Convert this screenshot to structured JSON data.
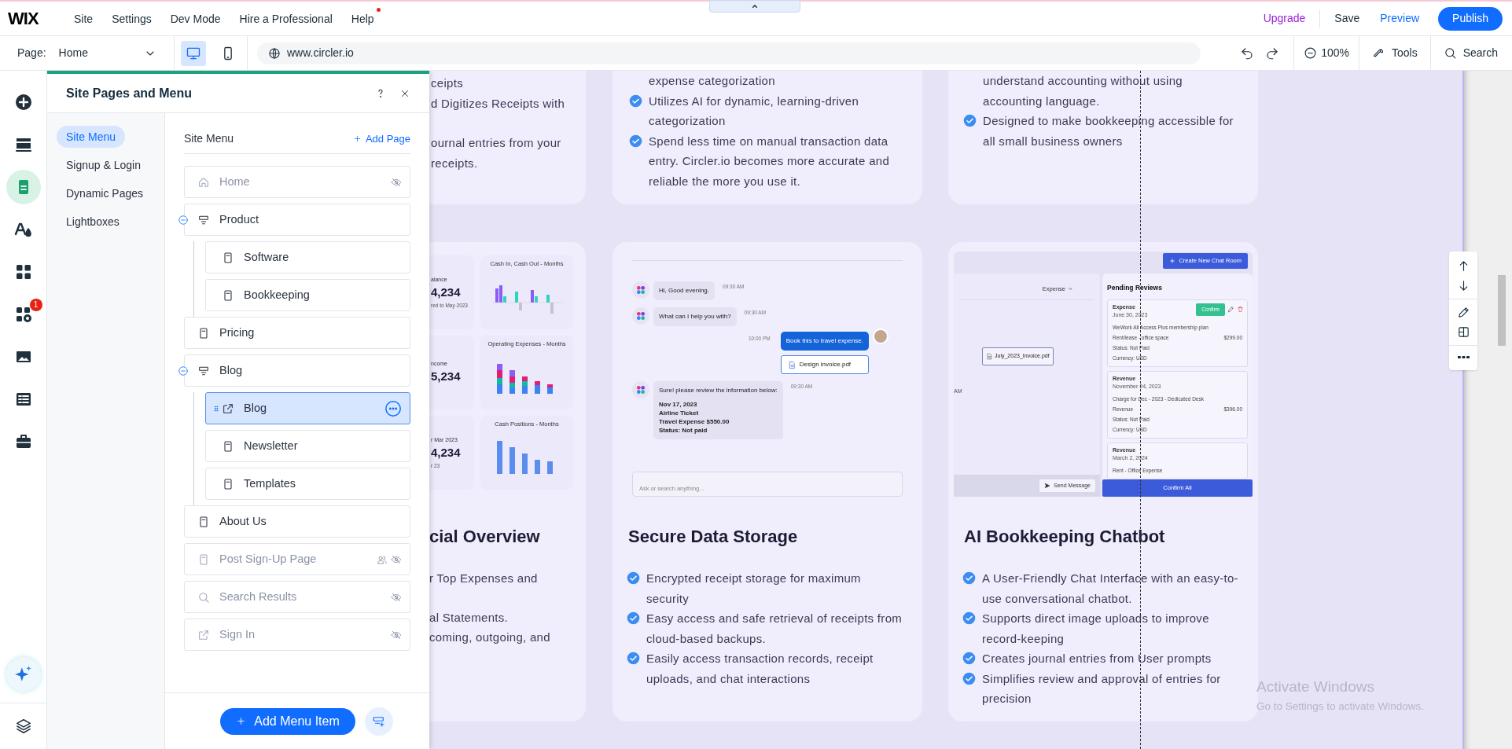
{
  "top_bar": {
    "logo": "WIX",
    "menu": [
      {
        "label": "Site"
      },
      {
        "label": "Settings"
      },
      {
        "label": "Dev Mode"
      },
      {
        "label": "Hire a Professional"
      },
      {
        "label": "Help",
        "notification": true
      }
    ],
    "upgrade": "Upgrade",
    "save": "Save",
    "preview": "Preview",
    "publish": "Publish"
  },
  "toolbar": {
    "page_label": "Page:",
    "page": "Home",
    "views": [
      {
        "kind": "desktop",
        "selected": true
      },
      {
        "kind": "mobile",
        "selected": false
      }
    ],
    "url": "www.circler.io",
    "zoom": "100%",
    "tools": "Tools",
    "search": "Search"
  },
  "left_rail": [
    {
      "kind": "add",
      "selected": false
    },
    {
      "kind": "sections",
      "selected": false
    },
    {
      "kind": "pages",
      "selected": true
    },
    {
      "kind": "design",
      "selected": false
    },
    {
      "kind": "apps",
      "selected": false
    },
    {
      "kind": "market",
      "selected": false,
      "badge": "1"
    },
    {
      "kind": "media",
      "selected": false
    },
    {
      "kind": "cms",
      "selected": false
    },
    {
      "kind": "business",
      "selected": false
    }
  ],
  "rail_bottom": [
    {
      "kind": "ai"
    },
    {
      "kind": "layers"
    }
  ],
  "panel": {
    "title": "Site Pages and Menu",
    "nav": [
      {
        "label": "Site Menu",
        "selected": true
      },
      {
        "label": "Signup & Login",
        "selected": false
      },
      {
        "label": "Dynamic Pages",
        "selected": false
      },
      {
        "label": "Lightboxes",
        "selected": false
      }
    ],
    "list_title": "Site Menu",
    "add_page": "Add Page",
    "add_menu_item": "Add Menu Item",
    "pages": [
      {
        "label": "Home",
        "kind": "home",
        "hidden": true,
        "selected": false
      },
      {
        "label": "Product",
        "kind": "folder",
        "hidden": false,
        "selected": false,
        "expanded": true,
        "children": [
          {
            "label": "Software",
            "kind": "page",
            "hidden": false,
            "selected": false
          },
          {
            "label": "Bookkeeping",
            "kind": "page",
            "hidden": false,
            "selected": false
          }
        ]
      },
      {
        "label": "Pricing",
        "kind": "page",
        "hidden": false,
        "selected": false
      },
      {
        "label": "Blog",
        "kind": "folder",
        "hidden": false,
        "selected": false,
        "expanded": true,
        "children": [
          {
            "label": "Blog",
            "kind": "link",
            "hidden": false,
            "selected": true
          },
          {
            "label": "Newsletter",
            "kind": "page",
            "hidden": false,
            "selected": false
          },
          {
            "label": "Templates",
            "kind": "page",
            "hidden": false,
            "selected": false
          }
        ]
      },
      {
        "label": "About Us",
        "kind": "page",
        "hidden": false,
        "selected": false
      },
      {
        "label": "Post Sign-Up Page",
        "kind": "page",
        "hidden": true,
        "selected": false,
        "members_only": true
      },
      {
        "label": "Search Results",
        "kind": "search",
        "hidden": true,
        "selected": false
      },
      {
        "label": "Sign In",
        "kind": "link",
        "hidden": true,
        "selected": false
      }
    ]
  },
  "cards": [
    {
      "kind": "cut_off",
      "top_groups": [
        [
          "ceipts",
          "d Digitizes Receipts with"
        ],
        [
          "ournal entries from your",
          "receipts."
        ]
      ],
      "image": {
        "kind": "dashboard",
        "tiles": [
          {
            "label": "alance",
            "value": "4,234",
            "note": "red to May 2023"
          },
          {
            "label": "ncome",
            "value": "5,234"
          },
          {
            "label": "r Mar 2023",
            "value": "4,234",
            "note": "r 23"
          }
        ],
        "charts": [
          "Cash In, Cash Out - Months",
          "Operating Expenses - Months",
          "Cash Positions - Months"
        ]
      },
      "heading": "cial Overview",
      "bottom_groups": [
        [
          "r Top Expenses  and"
        ],
        [
          "al Statements.",
          "coming, outgoing, and"
        ]
      ]
    },
    {
      "kind": "full",
      "top_items": [
        {
          "text": "expense categorization",
          "kind": "continuation"
        },
        {
          "text": "Utilizes AI for dynamic, learning-driven categorization",
          "kind": "bullet"
        },
        {
          "text": "Spend less time on manual transaction data entry. Circler.io becomes more accurate and reliable the more you use it.",
          "kind": "bullet"
        }
      ],
      "image": {
        "kind": "chat",
        "messages": [
          {
            "kind": "bot",
            "text": "Hi, Good evening.",
            "time": "09:30 AM"
          },
          {
            "kind": "bot",
            "text": "What can I help you with?",
            "time": "09:30 AM"
          },
          {
            "kind": "user",
            "text": "Book this to travel expense.",
            "time": "10:00 PM",
            "attachment": "Design invoice.pdf"
          },
          {
            "kind": "bot",
            "text": "Sure! please review the information below:",
            "details": [
              "Nov 17, 2023",
              "Airline Ticket",
              "Travel Expense $550.00",
              "Status: Not paid"
            ],
            "time": "09:30 AM"
          }
        ],
        "input_placeholder": "Ask or search anything..."
      },
      "heading": "Secure Data Storage",
      "items": [
        {
          "text": "Encrypted receipt storage for maximum security",
          "kind": "bullet"
        },
        {
          "text": "Easy access and safe retrieval of receipts from cloud-based backups.",
          "kind": "bullet"
        },
        {
          "text": "Easily access transaction records, receipt uploads, and chat interactions",
          "kind": "bullet"
        }
      ]
    },
    {
      "kind": "full",
      "top_items": [
        {
          "text": "understand accounting without using accounting language.",
          "kind": "continuation"
        },
        {
          "text": "Designed to make bookkeeping accessible for all small business owners",
          "kind": "bullet"
        }
      ],
      "image": {
        "kind": "review",
        "new_chat": "Create New Chat Room",
        "filter": "Expense",
        "file": "July_2023_Invoice.pdf",
        "time_fragment": "AM",
        "send": "Send Message",
        "title": "Pending Reviews",
        "confirm_all": "Confirm All",
        "entries": [
          {
            "type": "Expense",
            "date": "June 30, 2023",
            "confirm": "Confirm",
            "lines": [
              {
                "text": "WeWork All Access Plus membership plan"
              },
              {
                "text": "Rent/lease - office space",
                "amount": "$299.00"
              },
              {
                "text": "Status: Not Paid"
              },
              {
                "text": "Currency: USD"
              }
            ]
          },
          {
            "type": "Revenue",
            "date": "November 24, 2023",
            "lines": [
              {
                "text": "Charge for Dec - 2023 - Dedicated Desk"
              },
              {
                "text": "Revenue",
                "amount": "$396.00"
              },
              {
                "text": "Status: Not Paid"
              },
              {
                "text": "Currency: USD"
              }
            ]
          },
          {
            "type": "Revenue",
            "date": "March 2, 2024",
            "lines": [
              {
                "text": "Rent - Office Expense"
              }
            ]
          }
        ]
      },
      "heading": "AI Bookkeeping Chatbot",
      "items": [
        {
          "text": "A User-Friendly Chat Interface with an easy-to-use conversational chatbot.",
          "kind": "bullet"
        },
        {
          "text": "Supports direct image uploads to improve record-keeping",
          "kind": "bullet"
        },
        {
          "text": "Creates journal entries from User prompts",
          "kind": "bullet"
        },
        {
          "text": "Simplifies review and approval of entries for precision",
          "kind": "bullet"
        }
      ]
    }
  ],
  "os_notice": {
    "title": "Activate Windows",
    "text": "Go to Settings to activate Windows."
  }
}
